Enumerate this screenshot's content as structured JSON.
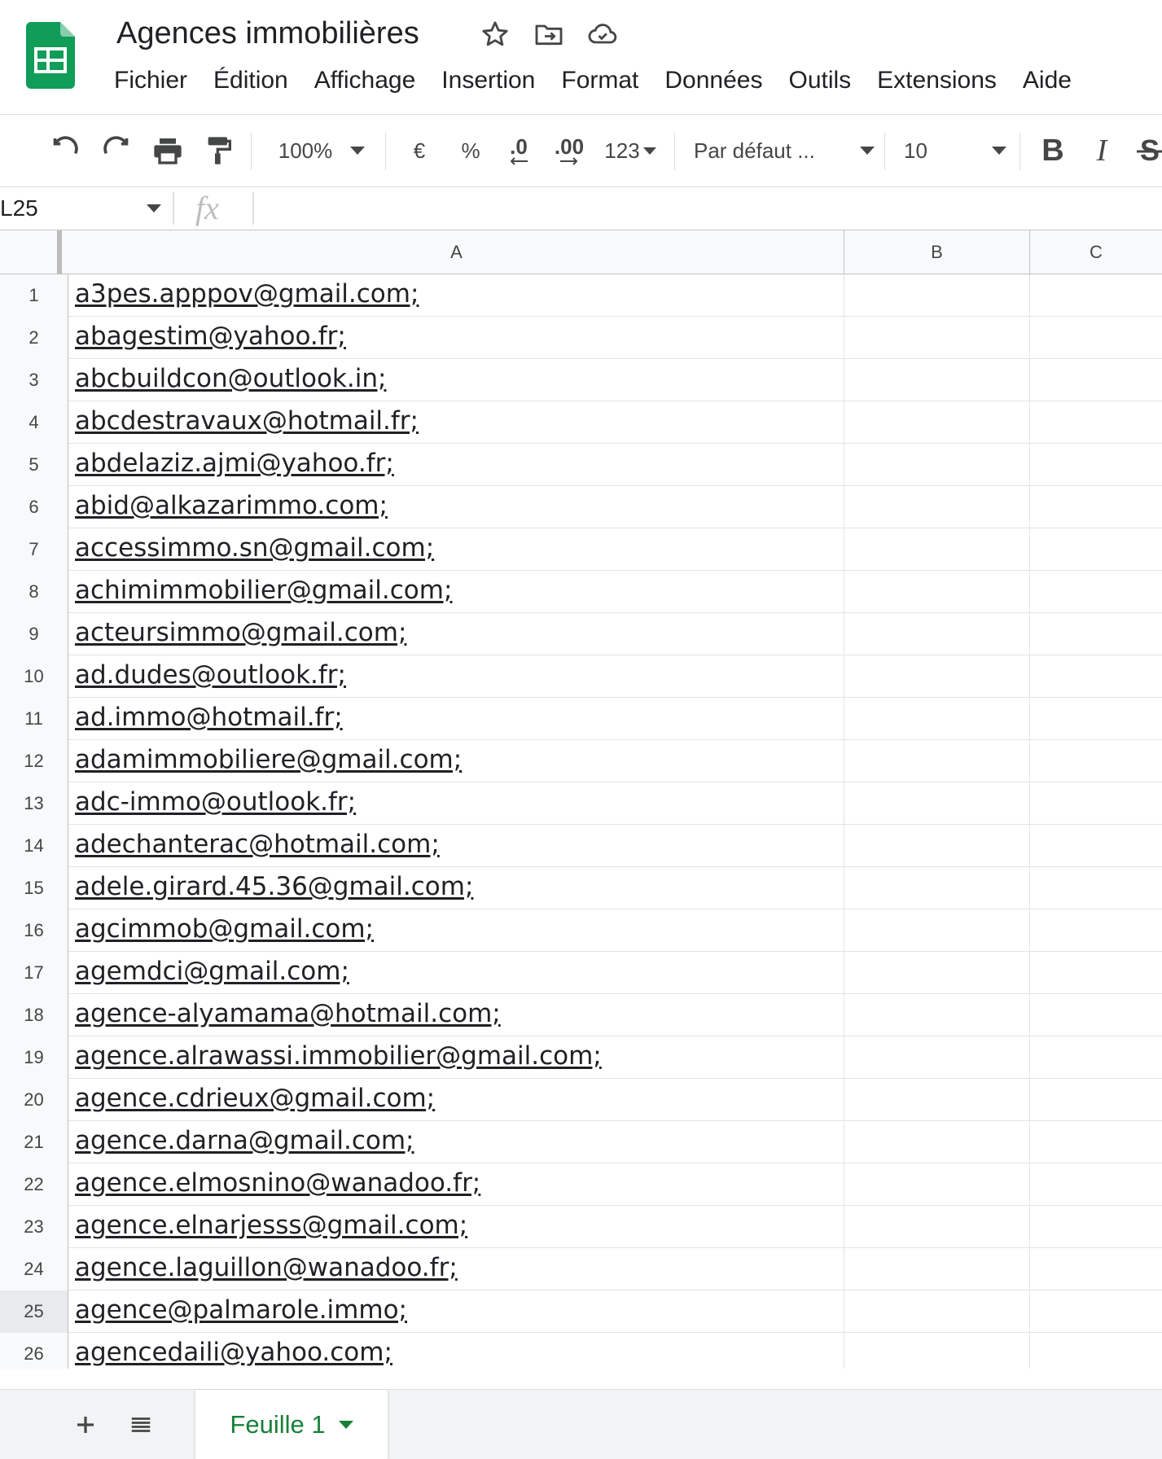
{
  "app": {
    "doc_title": "Agences immobilières",
    "menu": [
      "Fichier",
      "Édition",
      "Affichage",
      "Insertion",
      "Format",
      "Données",
      "Outils",
      "Extensions",
      "Aide"
    ]
  },
  "toolbar": {
    "zoom": "100%",
    "currency": "€",
    "percent": "%",
    "decimal_decrease": ".0",
    "decimal_increase": ".00",
    "number_format": "123",
    "font": "Par défaut ...",
    "font_size": "10",
    "bold": "B",
    "italic": "I"
  },
  "formula_bar": {
    "name_box": "L25",
    "fx": "fx",
    "value": ""
  },
  "grid": {
    "columns": [
      "A",
      "B",
      "C"
    ],
    "selected_row": 25,
    "rows": [
      {
        "num": "1",
        "a": "a3pes.apppov@gmail.com;"
      },
      {
        "num": "2",
        "a": "abagestim@yahoo.fr;"
      },
      {
        "num": "3",
        "a": "abcbuildcon@outlook.in;"
      },
      {
        "num": "4",
        "a": "abcdestravaux@hotmail.fr;"
      },
      {
        "num": "5",
        "a": "abdelaziz.ajmi@yahoo.fr;"
      },
      {
        "num": "6",
        "a": "abid@alkazarimmo.com;"
      },
      {
        "num": "7",
        "a": "accessimmo.sn@gmail.com;"
      },
      {
        "num": "8",
        "a": "achimimmobilier@gmail.com;"
      },
      {
        "num": "9",
        "a": "acteursimmo@gmail.com;"
      },
      {
        "num": "10",
        "a": "ad.dudes@outlook.fr;"
      },
      {
        "num": "11",
        "a": "ad.immo@hotmail.fr;"
      },
      {
        "num": "12",
        "a": "adamimmobiliere@gmail.com;"
      },
      {
        "num": "13",
        "a": "adc-immo@outlook.fr;"
      },
      {
        "num": "14",
        "a": "adechanterac@hotmail.com;"
      },
      {
        "num": "15",
        "a": "adele.girard.45.36@gmail.com;"
      },
      {
        "num": "16",
        "a": "agcimmob@gmail.com;"
      },
      {
        "num": "17",
        "a": "agemdci@gmail.com;"
      },
      {
        "num": "18",
        "a": "agence-alyamama@hotmail.com;"
      },
      {
        "num": "19",
        "a": "agence.alrawassi.immobilier@gmail.com;"
      },
      {
        "num": "20",
        "a": "agence.cdrieux@gmail.com;"
      },
      {
        "num": "21",
        "a": "agence.darna@gmail.com;"
      },
      {
        "num": "22",
        "a": "agence.elmosnino@wanadoo.fr;"
      },
      {
        "num": "23",
        "a": "agence.elnarjesss@gmail.com;"
      },
      {
        "num": "24",
        "a": "agence.laguillon@wanadoo.fr;"
      },
      {
        "num": "25",
        "a": "agence@palmarole.immo;"
      },
      {
        "num": "26",
        "a": "agencedaili@yahoo.com;"
      }
    ]
  },
  "sheets": {
    "tabs": [
      "Feuille 1"
    ],
    "active": "Feuille 1"
  },
  "colors": {
    "brand_green": "#0f9d58",
    "tab_text": "#188038",
    "grid_line": "#e2e3e3",
    "header_bg": "#f8f9fa"
  },
  "icons": [
    "sheets-logo-icon",
    "star-icon",
    "move-folder-icon",
    "cloud-saved-icon",
    "undo-icon",
    "redo-icon",
    "print-icon",
    "paint-format-icon",
    "chevron-down-icon",
    "add-sheet-icon",
    "all-sheets-icon"
  ]
}
